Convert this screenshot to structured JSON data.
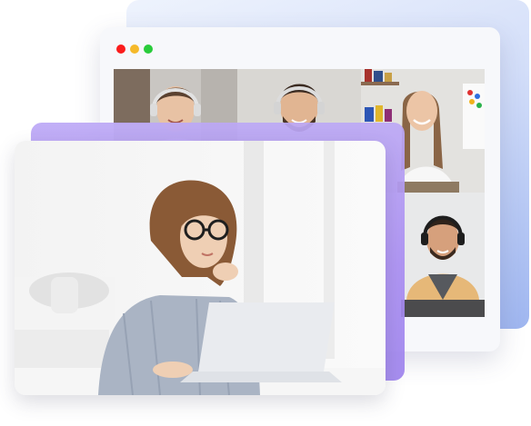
{
  "window": {
    "controls": [
      "close",
      "minimize",
      "maximize"
    ],
    "colors": {
      "close": "#fb1c1c",
      "minimize": "#f5b92a",
      "maximize": "#29cc3b"
    }
  },
  "participants": [
    {
      "id": "woman-headset",
      "position": "grid-top-left"
    },
    {
      "id": "man-headset",
      "position": "grid-top-middle"
    },
    {
      "id": "woman-smiling",
      "position": "grid-top-right"
    },
    {
      "id": "man-headset-2",
      "position": "grid-middle-right"
    }
  ],
  "main_view": {
    "subject": "woman-with-glasses-on-laptop"
  },
  "colors": {
    "accent_purple": "#aa8ef2",
    "accent_blue": "#9fb6f0"
  }
}
